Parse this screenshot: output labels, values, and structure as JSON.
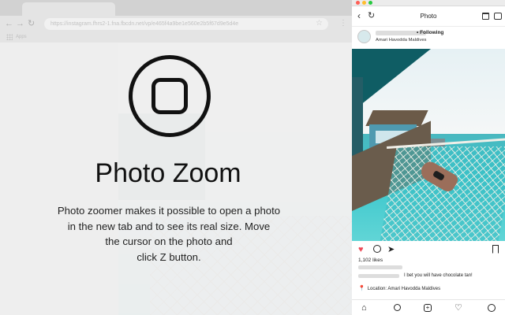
{
  "left_browser": {
    "url": "https://instagram.fhrs2-1.fna.fbcdn.net/vp/e465f4a9be1e560e2b5f67d9e5d4e",
    "bookmarks_label": "Apps"
  },
  "promo": {
    "title": "Photo Zoom",
    "description_lines": [
      "Photo zoomer makes it possible to open a photo",
      "in the new tab and to see its real size. Move",
      "the cursor on the photo and",
      "click Z button."
    ]
  },
  "mobile": {
    "nav_title": "Photo",
    "post": {
      "following_label": "• Following",
      "location_subtitle": "Amari Havodda Maldives",
      "likes": "1,102 likes",
      "comment_text": "I bet you will have chocolate tan!",
      "location_line": "Location: Amari Havodda Maldives"
    }
  },
  "colors": {
    "mac_close": "#ff5f56",
    "mac_minimize": "#ffbd2e",
    "mac_maximize": "#27c93f",
    "heart_red": "#ed4956"
  }
}
